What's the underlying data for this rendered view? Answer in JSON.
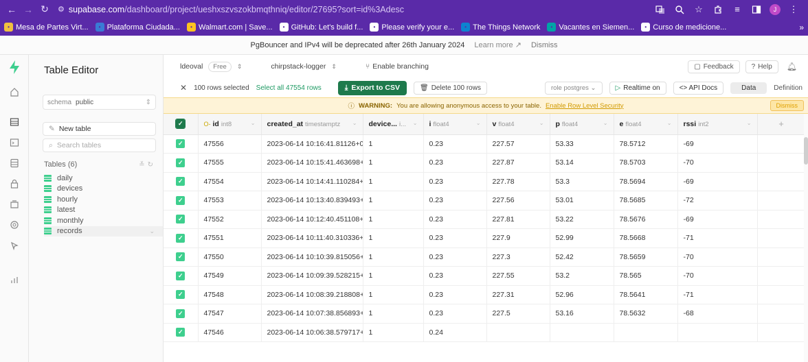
{
  "browser": {
    "url_host": "supabase.com",
    "url_path": "/dashboard/project/ueshxszvszokbmqthniq/editor/27695?sort=id%3Adesc",
    "profile_initial": "J",
    "bookmarks": [
      {
        "label": "Mesa de Partes Virt...",
        "icon": "seal-icon",
        "color": "#f0c040"
      },
      {
        "label": "Plataforma Ciudada...",
        "icon": "gob-icon",
        "color": "#3a7bd5"
      },
      {
        "label": "Walmart.com | Save...",
        "icon": "walmart-spark-icon",
        "color": "#ffc220"
      },
      {
        "label": "GitHub: Let's build f...",
        "icon": "github-icon",
        "color": "#ffffff"
      },
      {
        "label": "Please verify your e...",
        "icon": "github-icon",
        "color": "#ffffff"
      },
      {
        "label": "The Things Network",
        "icon": "ttn-cloud-icon",
        "color": "#0d83d0"
      },
      {
        "label": "Vacantes en Siemen...",
        "icon": "siemens-s-icon",
        "color": "#00a3a6"
      },
      {
        "label": "Curso de medicione...",
        "icon": "course-icon",
        "color": "#ffffff"
      }
    ],
    "more": "»"
  },
  "banner": {
    "message": "PgBouncer and IPv4 will be deprecated after 26th January 2024",
    "learn_more": "Learn more",
    "dismiss": "Dismiss"
  },
  "sidebar": {
    "title": "Table Editor",
    "schema_label": "schema",
    "schema_value": "public",
    "new_table": "New table",
    "search_placeholder": "Search tables",
    "tables_header": "Tables (6)",
    "tables": [
      "daily",
      "devices",
      "hourly",
      "latest",
      "monthly",
      "records"
    ]
  },
  "topbar": {
    "org": "ldeoval",
    "plan": "Free",
    "project": "chirpstack-logger",
    "branching": "Enable branching",
    "feedback": "Feedback",
    "help": "Help"
  },
  "actions": {
    "rows_selected": "100 rows selected",
    "select_all": "Select all 47554 rows",
    "export": "Export to CSV",
    "delete": "Delete 100 rows",
    "role": "role postgres",
    "realtime": "Realtime on",
    "api_docs": "API Docs",
    "tab_data": "Data",
    "tab_definition": "Definition"
  },
  "warning": {
    "label": "WARNING:",
    "text": "You are allowing anonymous access to your table.",
    "link": "Enable Row Level Security",
    "dismiss": "Dismiss"
  },
  "table": {
    "columns": [
      {
        "name": "id",
        "type": "int8"
      },
      {
        "name": "created_at",
        "type": "timestamptz"
      },
      {
        "name": "device...",
        "type": "i..."
      },
      {
        "name": "i",
        "type": "float4"
      },
      {
        "name": "v",
        "type": "float4"
      },
      {
        "name": "p",
        "type": "float4"
      },
      {
        "name": "e",
        "type": "float4"
      },
      {
        "name": "rssi",
        "type": "int2"
      }
    ],
    "rows": [
      [
        "47556",
        "2023-06-14 10:16:41.81126+00",
        "1",
        "0.23",
        "227.57",
        "53.33",
        "78.5712",
        "-69"
      ],
      [
        "47555",
        "2023-06-14 10:15:41.463698+0C",
        "1",
        "0.23",
        "227.87",
        "53.14",
        "78.5703",
        "-70"
      ],
      [
        "47554",
        "2023-06-14 10:14:41.110284+00",
        "1",
        "0.23",
        "227.78",
        "53.3",
        "78.5694",
        "-69"
      ],
      [
        "47553",
        "2023-06-14 10:13:40.839493+0",
        "1",
        "0.23",
        "227.56",
        "53.01",
        "78.5685",
        "-72"
      ],
      [
        "47552",
        "2023-06-14 10:12:40.451108+00",
        "1",
        "0.23",
        "227.81",
        "53.22",
        "78.5676",
        "-69"
      ],
      [
        "47551",
        "2023-06-14 10:11:40.310336+00",
        "1",
        "0.23",
        "227.9",
        "52.99",
        "78.5668",
        "-71"
      ],
      [
        "47550",
        "2023-06-14 10:10:39.815056+0C",
        "1",
        "0.23",
        "227.3",
        "52.42",
        "78.5659",
        "-70"
      ],
      [
        "47549",
        "2023-06-14 10:09:39.528215+0",
        "1",
        "0.23",
        "227.55",
        "53.2",
        "78.565",
        "-70"
      ],
      [
        "47548",
        "2023-06-14 10:08:39.218808+0",
        "1",
        "0.23",
        "227.31",
        "52.96",
        "78.5641",
        "-71"
      ],
      [
        "47547",
        "2023-06-14 10:07:38.856893+0",
        "1",
        "0.23",
        "227.5",
        "53.16",
        "78.5632",
        "-68"
      ],
      [
        "47546",
        "2023-06-14 10:06:38.579717+0C",
        "1",
        "0.24",
        "",
        "",
        "",
        ""
      ]
    ]
  }
}
